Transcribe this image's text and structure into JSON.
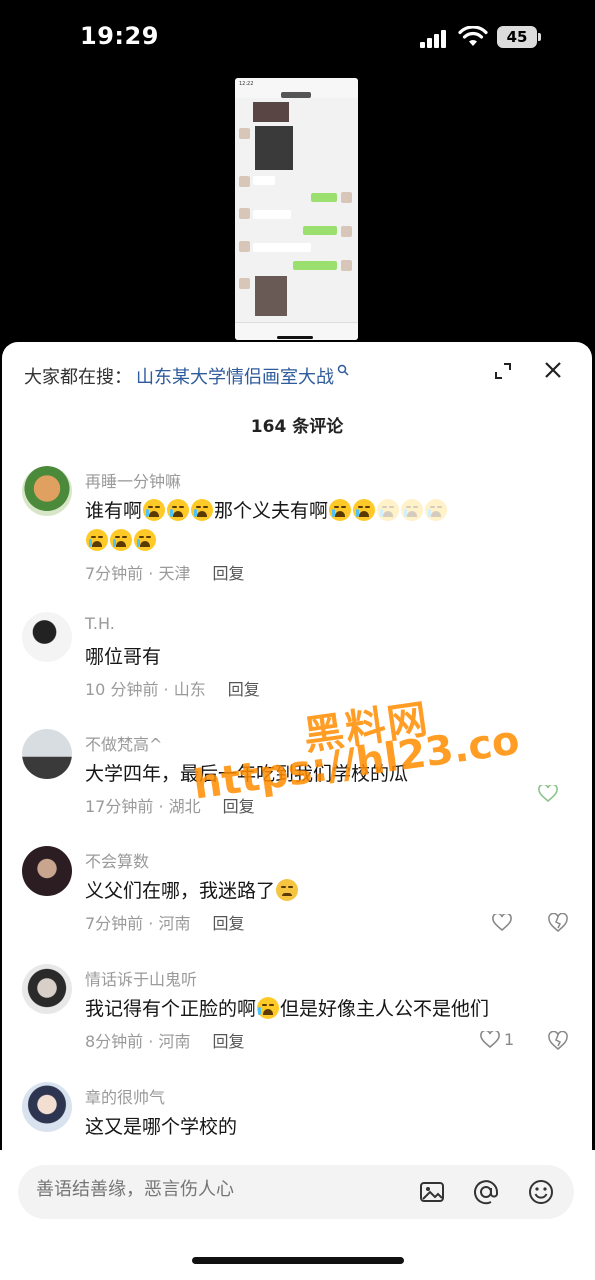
{
  "status_bar": {
    "time": "19:29",
    "battery": "45"
  },
  "video": {
    "screen_time": "12:22",
    "header_text": "子ㄐ钝"
  },
  "sheet": {
    "search_prefix": "大家都在搜：",
    "search_term": "山东某大学情侣画室大战",
    "comment_count": "164 条评论"
  },
  "comments": [
    {
      "user": "再睡一分钟嘛",
      "text": "谁有啊",
      "text2": "那个义夫有啊",
      "time": "7分钟前",
      "location": "天津",
      "reply": "回复"
    },
    {
      "user": "T.H.",
      "text": "哪位哥有",
      "time": "10 分钟前",
      "location": "山东",
      "reply": "回复"
    },
    {
      "user": "不做梵高^",
      "text": "大学四年，最后一年吃到我们学校的瓜",
      "time": "17分钟前",
      "location": "湖北",
      "reply": "回复"
    },
    {
      "user": "不会算数",
      "text": "义父们在哪，我迷路了",
      "time": "7分钟前",
      "location": "河南",
      "reply": "回复"
    },
    {
      "user": "情话诉于山鬼听",
      "text": "我记得有个正脸的啊",
      "text2": "但是好像主人公不是他们",
      "time": "8分钟前",
      "location": "河南",
      "reply": "回复",
      "likes": "1"
    },
    {
      "user": "章的很帅气",
      "text": "这又是哪个学校的",
      "time": "",
      "location": "",
      "reply": ""
    }
  ],
  "watermark": {
    "line1": "黑料网",
    "line2": "https://hl23.co"
  },
  "input": {
    "placeholder": "善语结善缘，恶言伤人心"
  },
  "icons": [
    "search-icon",
    "expand-icon",
    "close-icon",
    "heart-icon",
    "dislike-icon",
    "image-icon",
    "at-icon",
    "emoji-icon"
  ]
}
